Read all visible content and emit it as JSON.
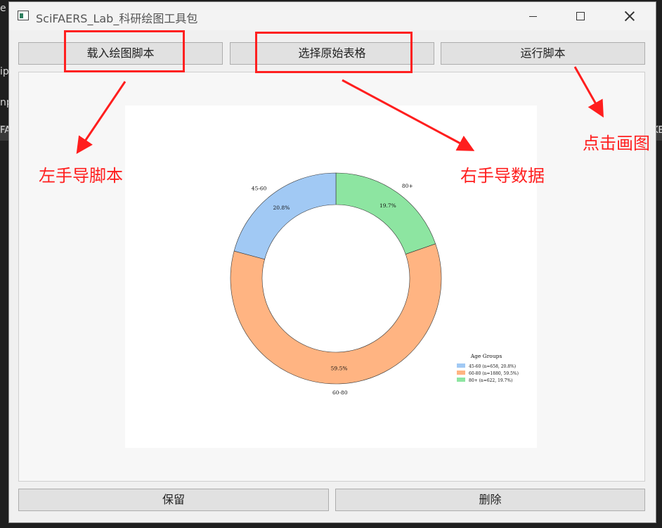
{
  "window": {
    "title": "SciFAERS_Lab_科研绘图工具包"
  },
  "toolbar": {
    "load_script": "载入绘图脚本",
    "select_table": "选择原始表格",
    "run_script": "运行脚本"
  },
  "bottom_bar": {
    "keep": "保留",
    "delete": "删除"
  },
  "annotations": {
    "left_hint": "左手导脚本",
    "right_hint": "右手导数据",
    "click_hint": "点击画图",
    "color": "#ff1e1e"
  },
  "background_fragments": {
    "f1": "e",
    "f2": "ip",
    "f3": "np",
    "f4": "FA",
    "f5": "KE"
  },
  "chart_data": {
    "type": "pie",
    "donut": true,
    "start_angle_deg": 0,
    "direction": "clockwise",
    "categories": [
      "80+",
      "60-80",
      "45-60"
    ],
    "values": [
      622,
      1880,
      658
    ],
    "percent_labels": [
      "19.7%",
      "59.5%",
      "20.8%"
    ],
    "colors": [
      "#8de5a1",
      "#ffb482",
      "#a1c9f4"
    ],
    "legend": {
      "title": "Age Groups",
      "placement": "lower-right",
      "entries": [
        {
          "label": "45-60 (n=658, 20.8%)",
          "color": "#a1c9f4"
        },
        {
          "label": "60-80 (n=1880, 59.5%)",
          "color": "#ffb482"
        },
        {
          "label": "80+ (n=622, 19.7%)",
          "color": "#8de5a1"
        }
      ]
    }
  }
}
